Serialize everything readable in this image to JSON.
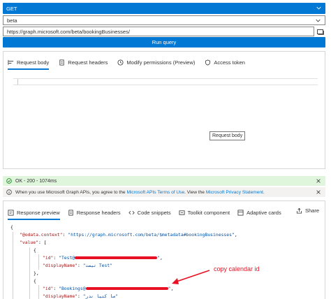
{
  "request": {
    "method": "GET",
    "version": "beta",
    "url": "https://graph.microsoft.com/beta/bookingBusinesses/",
    "run_label": "Run query"
  },
  "request_tabs": [
    {
      "label": "Request body",
      "icon": "request-body-icon",
      "active": true
    },
    {
      "label": "Request headers",
      "icon": "document-icon",
      "active": false
    },
    {
      "label": "Modify permissions (Preview)",
      "icon": "clock-icon",
      "active": false
    },
    {
      "label": "Access token",
      "icon": "shield-icon",
      "active": false
    }
  ],
  "tooltip": "Request body",
  "status": {
    "ok_text": "OK - 200 - 1074ms",
    "info_prefix": "When you use Microsoft Graph APIs, you agree to the ",
    "info_link1": "Microsoft APIs Terms of Use",
    "info_mid": ". View the ",
    "info_link2": "Microsoft Privacy Statement",
    "info_suffix": "."
  },
  "response_tabs": [
    {
      "label": "Response preview",
      "icon": "response-preview-icon",
      "active": true
    },
    {
      "label": "Response headers",
      "icon": "document-icon",
      "active": false
    },
    {
      "label": "Code snippets",
      "icon": "code-icon",
      "active": false
    },
    {
      "label": "Toolkit component",
      "icon": "toolkit-icon",
      "active": false
    },
    {
      "label": "Adaptive cards",
      "icon": "cards-icon",
      "active": false
    }
  ],
  "share_label": "Share",
  "code": {
    "open_brace": "{",
    "context_key": "\"@odata.context\"",
    "context_val": "\"https://graph.microsoft.com/beta/$metadata#bookingBusinesses\"",
    "value_key": "\"value\"",
    "open_bracket": "[",
    "item_open": "{",
    "id_key": "\"id\"",
    "id1_prefix": "\"Test@",
    "display_key": "\"displayName\"",
    "display1": "\"تیست Test\"",
    "item_close": "},",
    "id2_prefix": "\"Bookings@",
    "display2": "\"سا کتیا ندر\""
  },
  "annotation": "copy calendar id",
  "colors": {
    "accent": "#0078d4",
    "success_bg": "#dff6dd",
    "annotation": "#e81123"
  }
}
